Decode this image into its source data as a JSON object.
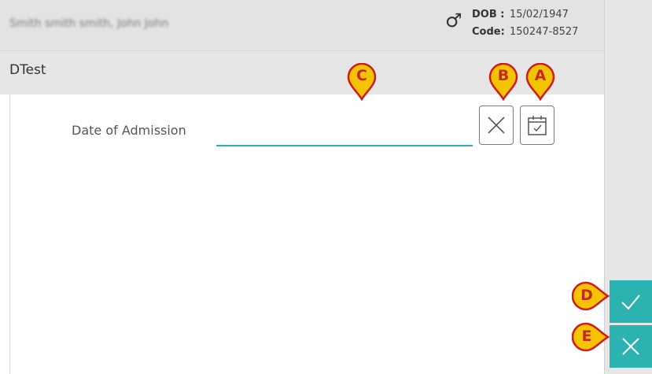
{
  "header": {
    "patient_name": "Smith smith smith, John John",
    "gender_symbol": "♂",
    "dob_label": "DOB :",
    "dob_value": "15/02/1947",
    "code_label": "Code:",
    "code_value": "150247-8527"
  },
  "form": {
    "title": "DTest",
    "field_label": "Date of Admission",
    "field_value": ""
  },
  "icons": {
    "clear": "close-icon",
    "calendar": "calendar-check-icon",
    "confirm": "checkmark-icon",
    "cancel": "close-icon"
  },
  "markers": {
    "a": "A",
    "b": "B",
    "c": "C",
    "d": "D",
    "e": "E"
  },
  "colors": {
    "accent": "#2ab3b0",
    "marker_fill": "#f5c400",
    "marker_text": "#c62828",
    "header_bg": "#e3e3e3"
  }
}
